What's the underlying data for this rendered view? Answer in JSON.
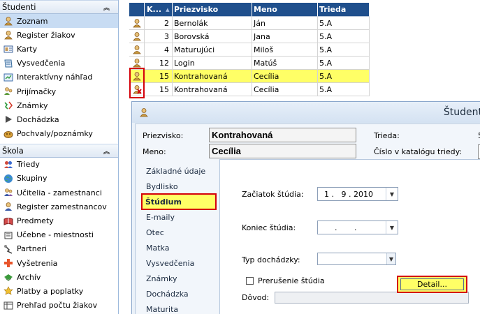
{
  "nav": {
    "students_header": "Študenti",
    "students_items": [
      {
        "label": "Zoznam",
        "icon": "students-list-icon",
        "selected": true
      },
      {
        "label": "Register žiakov",
        "icon": "register-icon"
      },
      {
        "label": "Karty",
        "icon": "cards-icon"
      },
      {
        "label": "Vysvedčenia",
        "icon": "certificate-icon"
      },
      {
        "label": "Interaktívny náhľad",
        "icon": "preview-icon"
      },
      {
        "label": "Prijímačky",
        "icon": "admission-icon"
      },
      {
        "label": "Známky",
        "icon": "grades-icon"
      },
      {
        "label": "Dochádzka",
        "icon": "attendance-icon"
      },
      {
        "label": "Pochvaly/poznámky",
        "icon": "praise-icon"
      }
    ],
    "school_header": "Škola",
    "school_items": [
      {
        "label": "Triedy",
        "icon": "classes-icon"
      },
      {
        "label": "Skupiny",
        "icon": "groups-icon"
      },
      {
        "label": "Učitelia - zamestnanci",
        "icon": "teachers-icon"
      },
      {
        "label": "Register zamestnancov",
        "icon": "staff-register-icon"
      },
      {
        "label": "Predmety",
        "icon": "subjects-icon"
      },
      {
        "label": "Učebne - miestnosti",
        "icon": "classrooms-icon"
      },
      {
        "label": "Partneri",
        "icon": "partners-icon"
      },
      {
        "label": "Vyšetrenia",
        "icon": "examinations-icon"
      },
      {
        "label": "Archív",
        "icon": "archive-icon"
      },
      {
        "label": "Platby a poplatky",
        "icon": "payments-icon"
      },
      {
        "label": "Prehľad počtu žiakov",
        "icon": "overview-icon"
      }
    ]
  },
  "grid": {
    "columns": [
      "K...",
      "Priezvisko",
      "Meno",
      "Trieda"
    ],
    "rows": [
      {
        "num": "2",
        "surname": "Bernolák",
        "name": "Ján",
        "class": "5.A"
      },
      {
        "num": "3",
        "surname": "Borovská",
        "name": "Jana",
        "class": "5.A"
      },
      {
        "num": "4",
        "surname": "Maturujúci",
        "name": "Miloš",
        "class": "5.A"
      },
      {
        "num": "12",
        "surname": "Login",
        "name": "Matúš",
        "class": "5.A"
      },
      {
        "num": "15",
        "surname": "Kontrahovaná",
        "name": "Cecília",
        "class": "5.A",
        "highlight": true
      },
      {
        "num": "15",
        "surname": "Kontrahovaná",
        "name": "Cecília",
        "class": "5.A"
      }
    ]
  },
  "dialog": {
    "title": "Študent",
    "surname_label": "Priezvisko:",
    "surname_value": "Kontrahovaná",
    "name_label": "Meno:",
    "name_value": "Cecília",
    "class_label": "Trieda:",
    "class_value_fragment": "5",
    "catalog_label": "Číslo v katalógu triedy:",
    "tabs": [
      "Základné údaje",
      "Bydlisko",
      "Štúdium",
      "E-maily",
      "Otec",
      "Matka",
      "Vysvedčenia",
      "Známky",
      "Dochádzka",
      "Maturita"
    ],
    "active_tab": "Štúdium",
    "study_start_label": "Začiatok štúdia:",
    "study_start_value": "1 .   9 . 2010",
    "study_end_label": "Koniec štúdia:",
    "study_end_value": ".       .",
    "attendance_label": "Typ dochádzky:",
    "interruption_label": "Prerušenie štúdia",
    "detail_button": "Detail...",
    "reason_label": "Dôvod:"
  }
}
